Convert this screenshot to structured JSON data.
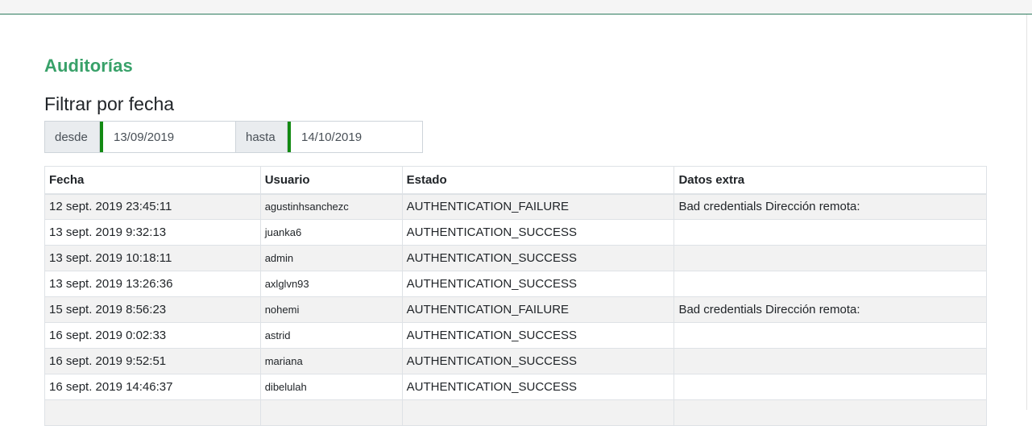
{
  "page": {
    "title": "Auditorías",
    "filter_heading": "Filtrar por fecha"
  },
  "filter": {
    "from_label": "desde",
    "from_value": "13/09/2019",
    "to_label": "hasta",
    "to_value": "14/10/2019"
  },
  "table": {
    "headers": [
      "Fecha",
      "Usuario",
      "Estado",
      "Datos extra"
    ],
    "rows": [
      {
        "fecha": "12 sept. 2019 23:45:11",
        "usuario": "agustinhsanchezc",
        "estado": "AUTHENTICATION_FAILURE",
        "extra": "Bad credentials Dirección remota:"
      },
      {
        "fecha": "13 sept. 2019 9:32:13",
        "usuario": "juanka6",
        "estado": "AUTHENTICATION_SUCCESS",
        "extra": ""
      },
      {
        "fecha": "13 sept. 2019 10:18:11",
        "usuario": "admin",
        "estado": "AUTHENTICATION_SUCCESS",
        "extra": ""
      },
      {
        "fecha": "13 sept. 2019 13:26:36",
        "usuario": "axlglvn93",
        "estado": "AUTHENTICATION_SUCCESS",
        "extra": ""
      },
      {
        "fecha": "15 sept. 2019 8:56:23",
        "usuario": "nohemi",
        "estado": "AUTHENTICATION_FAILURE",
        "extra": "Bad credentials Dirección remota:"
      },
      {
        "fecha": "16 sept. 2019 0:02:33",
        "usuario": "astrid",
        "estado": "AUTHENTICATION_SUCCESS",
        "extra": ""
      },
      {
        "fecha": "16 sept. 2019 9:52:51",
        "usuario": "mariana",
        "estado": "AUTHENTICATION_SUCCESS",
        "extra": ""
      },
      {
        "fecha": "16 sept. 2019 14:46:37",
        "usuario": "dibelulah",
        "estado": "AUTHENTICATION_SUCCESS",
        "extra": ""
      }
    ]
  },
  "colors": {
    "accent": "#38a169",
    "input_indicator": "#138a13"
  }
}
